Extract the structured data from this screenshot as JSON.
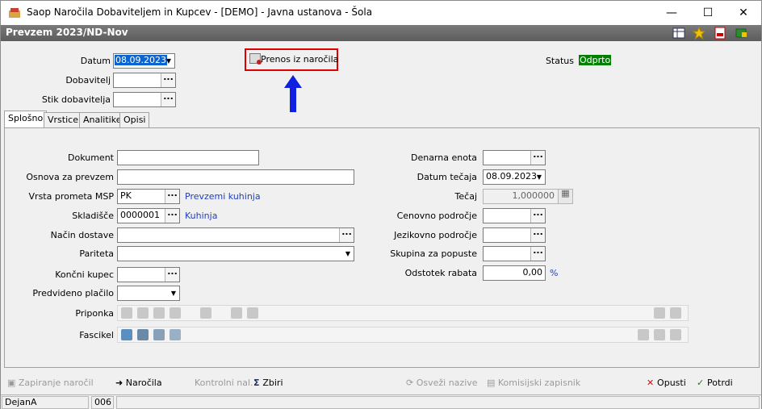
{
  "window": {
    "title": "Saop   Naročila Dobaviteljem in Kupcev -  [DEMO] - Javna ustanova - Šola"
  },
  "header": {
    "title": "Prevzem 2023/ND-Nov"
  },
  "top": {
    "datum_label": "Datum",
    "datum_value": "08.09.2023",
    "dobavitelj_label": "Dobavitelj",
    "dobavitelj_value": "",
    "stik_label": "Stik dobavitelja",
    "stik_value": "",
    "prenos_label": "Prenos iz naročila",
    "status_label": "Status",
    "status_value": "Odprto"
  },
  "tabs": [
    "Splošno",
    "Vrstice",
    "Analitike",
    "Opisi"
  ],
  "left": {
    "dokument_label": "Dokument",
    "dokument_value": "",
    "osnova_label": "Osnova za prevzem",
    "osnova_value": "",
    "vrsta_label": "Vrsta prometa MSP",
    "vrsta_value": "PK",
    "vrsta_link": "Prevzemi kuhinja",
    "skladisce_label": "Skladišče",
    "skladisce_value": "0000001",
    "skladisce_link": "Kuhinja",
    "nacin_label": "Način dostave",
    "nacin_value": "",
    "pariteta_label": "Pariteta",
    "pariteta_value": "",
    "koncni_label": "Končni kupec",
    "koncni_value": "",
    "placilo_label": "Predvideno plačilo",
    "placilo_value": "",
    "priponka_label": "Priponka",
    "fascikel_label": "Fascikel"
  },
  "right": {
    "denarna_label": "Denarna enota",
    "denarna_value": "",
    "datum_tecaja_label": "Datum tečaja",
    "datum_tecaja_value": "08.09.2023",
    "tecaj_label": "Tečaj",
    "tecaj_value": "1,000000",
    "cenovno_label": "Cenovno področje",
    "cenovno_value": "",
    "jezikovno_label": "Jezikovno področje",
    "jezikovno_value": "",
    "skupina_label": "Skupina za popuste",
    "skupina_value": "",
    "odstotek_label": "Odstotek rabata",
    "odstotek_value": "0,00",
    "odstotek_unit": "%"
  },
  "bottom": {
    "zapiranje": "Zapiranje naročil",
    "narocila": "Naročila",
    "kontrolni": "Kontrolni nal.",
    "zbiri": "Zbiri",
    "osvezi": "Osveži nazive",
    "komisijski": "Komisijski zapisnik",
    "opusti": "Opusti",
    "potrdi": "Potrdi"
  },
  "statusbar": {
    "user": "DejanA",
    "code": "006"
  },
  "colors": {
    "status_bg": "#008000",
    "status_fg": "#ffffff",
    "annotation": "#e00000",
    "arrow": "#1020e0"
  }
}
